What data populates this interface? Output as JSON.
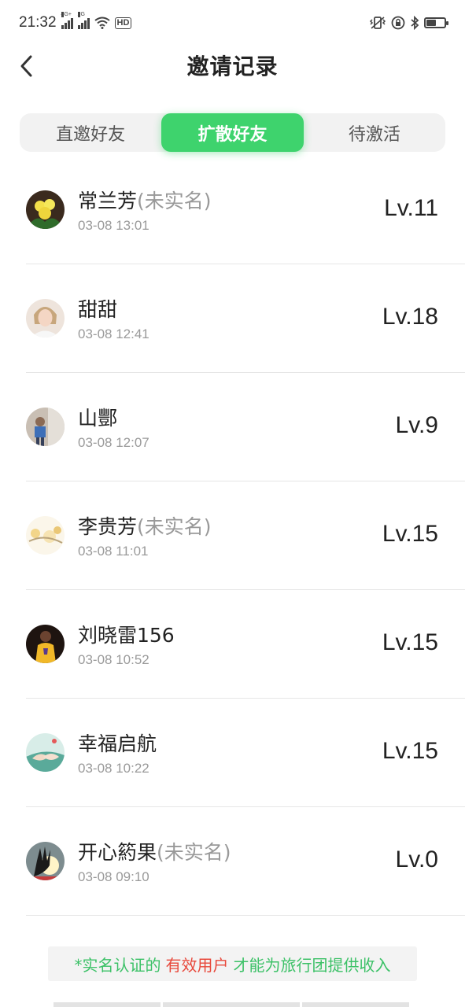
{
  "status_bar": {
    "time": "21:32",
    "net1": "4G+",
    "net2": "2G",
    "hd": "HD",
    "battery_level": 0.55,
    "icons": [
      "signal-4g-icon",
      "signal-2g-icon",
      "wifi-icon",
      "hd-icon",
      "vibrate-icon",
      "rotation-lock-icon",
      "bluetooth-icon",
      "battery-icon"
    ]
  },
  "header": {
    "title": "邀请记录",
    "back_icon": "chevron-left-icon"
  },
  "tabs": [
    {
      "label": "直邀好友",
      "active": false
    },
    {
      "label": "扩散好友",
      "active": true
    },
    {
      "label": "待激活",
      "active": false
    }
  ],
  "list": [
    {
      "name": "常兰芳",
      "tag": "(未实名)",
      "date": "03-08 13:01",
      "level": "Lv.11"
    },
    {
      "name": "甜甜",
      "tag": "",
      "date": "03-08 12:41",
      "level": "Lv.18"
    },
    {
      "name": "山酆",
      "tag": "",
      "date": "03-08 12:07",
      "level": "Lv.9"
    },
    {
      "name": "李贵芳",
      "tag": "(未实名)",
      "date": "03-08 11:01",
      "level": "Lv.15"
    },
    {
      "name": "刘晓雷156",
      "tag": "",
      "date": "03-08 10:52",
      "level": "Lv.15"
    },
    {
      "name": "幸福启航",
      "tag": "",
      "date": "03-08 10:22",
      "level": "Lv.15"
    },
    {
      "name": "开心箹果",
      "tag": "(未实名)",
      "date": "03-08 09:10",
      "level": "Lv.0"
    }
  ],
  "footer_note": {
    "part1": "*实名认证的",
    "part2": "有效用户",
    "part3": "才能为旅行团提供收入"
  },
  "colors": {
    "accent_green": "#3ed36d",
    "note_green": "#3cc167",
    "note_red": "#e8483b"
  }
}
